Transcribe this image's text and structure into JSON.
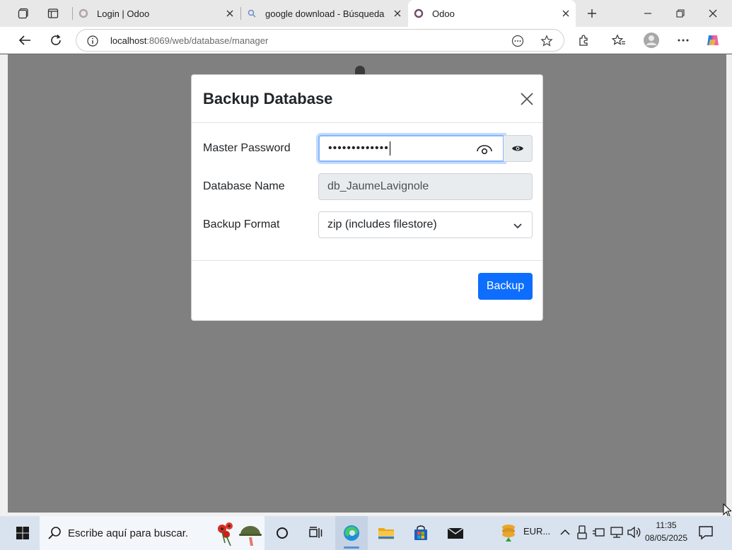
{
  "browser": {
    "tabs": [
      {
        "title": "Login | Odoo",
        "active": false
      },
      {
        "title": "google download - Búsqueda",
        "active": false
      },
      {
        "title": "Odoo",
        "active": true
      }
    ],
    "url_host": "localhost",
    "url_path": ":8069/web/database/manager"
  },
  "dialog": {
    "title": "Backup Database",
    "fields": {
      "master_password_label": "Master Password",
      "master_password_value": "•••••••••••••",
      "database_name_label": "Database Name",
      "database_name_value": "db_JaumeLavignole",
      "backup_format_label": "Backup Format",
      "backup_format_value": "zip (includes filestore)"
    },
    "backup_button": "Backup"
  },
  "taskbar": {
    "search_placeholder": "Escribe aquí para buscar.",
    "tray_label": "EUR...",
    "time": "11:35",
    "date": "08/05/2025"
  },
  "colors": {
    "primary_button": "#0d6efd",
    "focus_ring": "#86b7fe",
    "backdrop": "#808080"
  }
}
